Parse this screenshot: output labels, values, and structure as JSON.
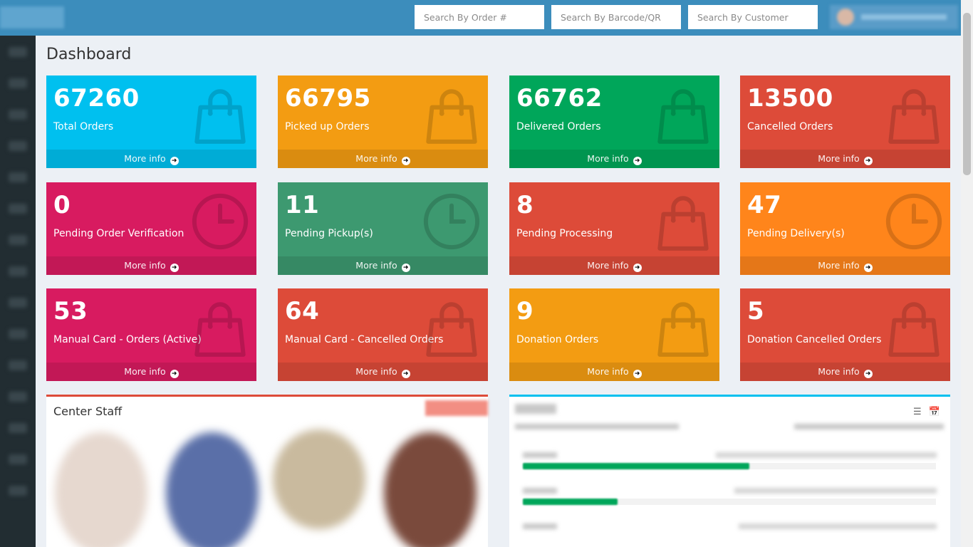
{
  "header": {
    "search_order_placeholder": "Search By Order #",
    "search_barcode_placeholder": "Search By Barcode/QR",
    "search_customer_placeholder": "Search By Customer"
  },
  "page": {
    "title": "Dashboard"
  },
  "stats": [
    {
      "value": "67260",
      "label": "Total Orders",
      "more": "More info",
      "icon": "shopping-bag-icon",
      "color": "#00c0ef"
    },
    {
      "value": "66795",
      "label": "Picked up Orders",
      "more": "More info",
      "icon": "shopping-bag-icon",
      "color": "#f39c12"
    },
    {
      "value": "66762",
      "label": "Delivered Orders",
      "more": "More info",
      "icon": "shopping-bag-icon",
      "color": "#00a65a"
    },
    {
      "value": "13500",
      "label": "Cancelled Orders",
      "more": "More info",
      "icon": "shopping-bag-icon",
      "color": "#dd4b39"
    },
    {
      "value": "0",
      "label": "Pending Order Verification",
      "more": "More info",
      "icon": "clock-icon",
      "color": "#d81b60"
    },
    {
      "value": "11",
      "label": "Pending Pickup(s)",
      "more": "More info",
      "icon": "clock-icon",
      "color": "#3d9970"
    },
    {
      "value": "8",
      "label": "Pending Processing",
      "more": "More info",
      "icon": "shopping-bag-icon",
      "color": "#dd4b39"
    },
    {
      "value": "47",
      "label": "Pending Delivery(s)",
      "more": "More info",
      "icon": "clock-icon",
      "color": "#ff851b"
    },
    {
      "value": "53",
      "label": "Manual Card - Orders (Active)",
      "more": "More info",
      "icon": "shopping-bag-icon",
      "color": "#d81b60"
    },
    {
      "value": "64",
      "label": "Manual Card - Cancelled Orders",
      "more": "More info",
      "icon": "shopping-bag-icon",
      "color": "#dd4b39"
    },
    {
      "value": "9",
      "label": "Donation Orders",
      "more": "More info",
      "icon": "shopping-bag-icon",
      "color": "#f39c12"
    },
    {
      "value": "5",
      "label": "Donation Cancelled Orders",
      "more": "More info",
      "icon": "shopping-bag-icon",
      "color": "#dd4b39"
    }
  ],
  "staff_panel": {
    "title": "Center Staff"
  },
  "activity_panel": {
    "list_icon": "list-icon",
    "calendar_icon": "calendar-icon"
  }
}
